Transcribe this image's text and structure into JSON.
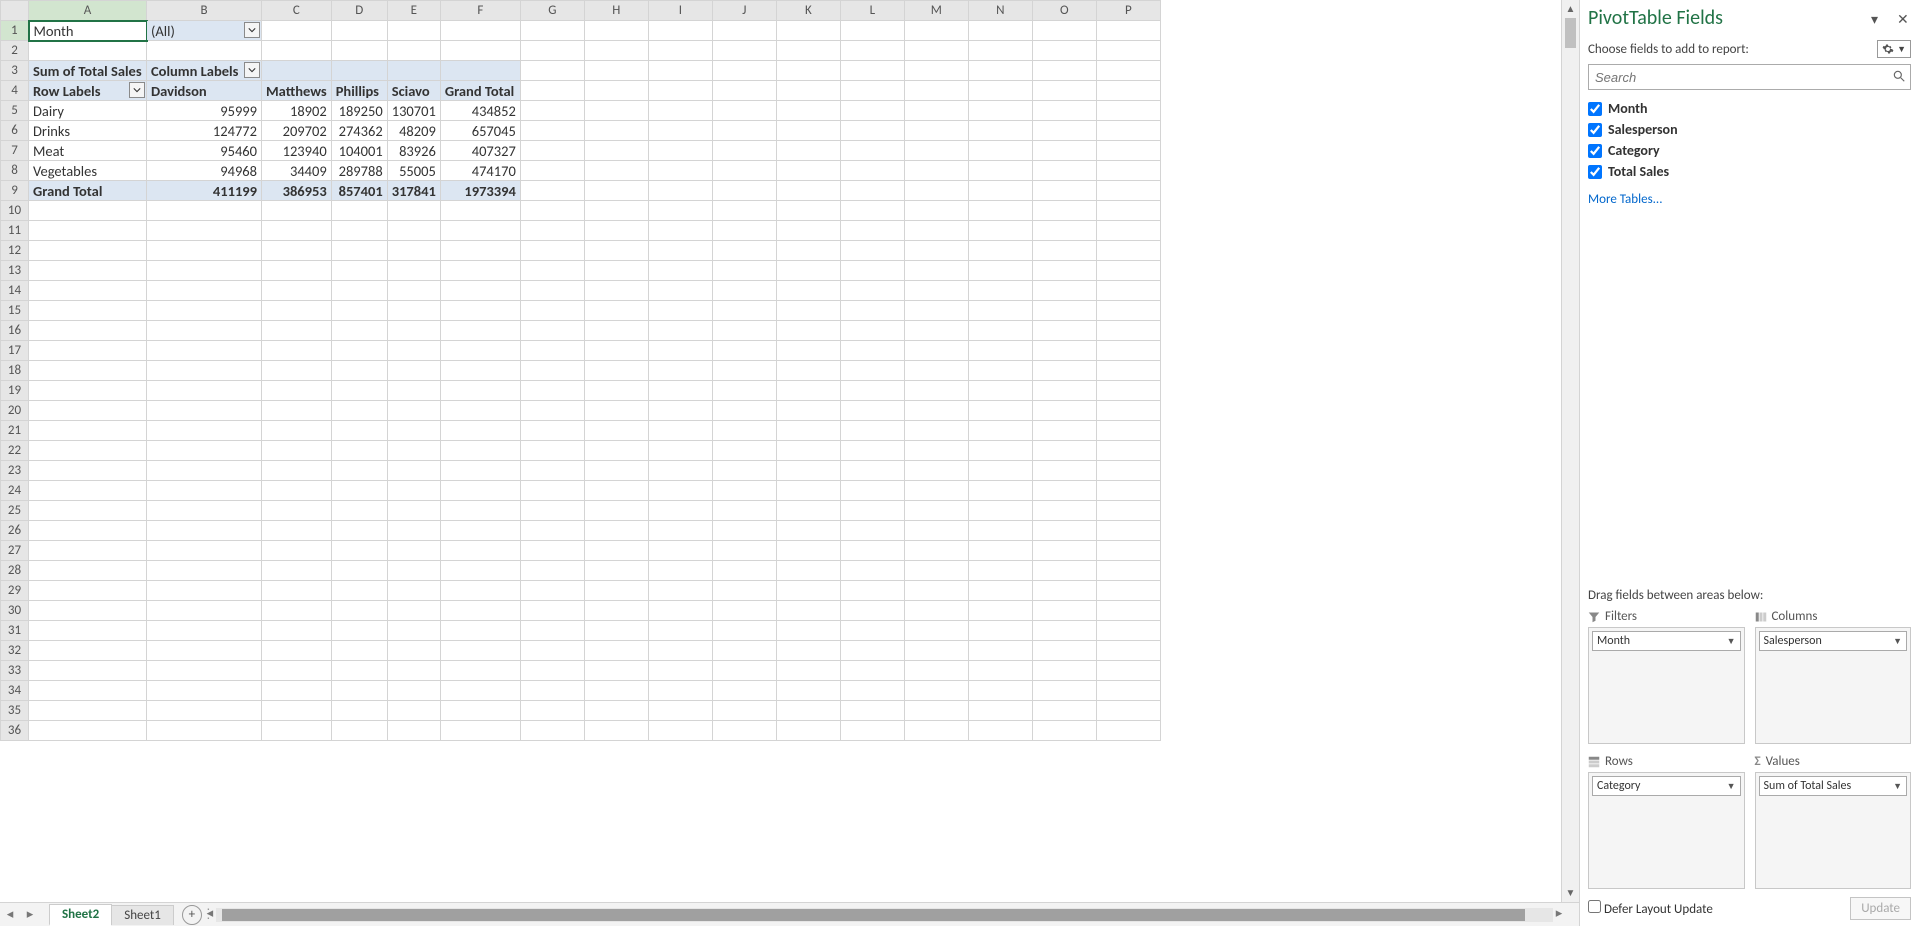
{
  "columns": [
    "A",
    "B",
    "C",
    "D",
    "E",
    "F",
    "G",
    "H",
    "I",
    "J",
    "K",
    "L",
    "M",
    "N",
    "O",
    "P"
  ],
  "rows": 36,
  "cell": {
    "A1": "Month",
    "B1": "(All)",
    "A3": "Sum of Total Sales",
    "B3": "Column Labels",
    "A4": "Row Labels",
    "B4": "Davidson",
    "C4": "Matthews",
    "D4": "Phillips",
    "E4": "Sciavo",
    "F4": "Grand Total",
    "A5": "Dairy",
    "B5": "95999",
    "C5": "18902",
    "D5": "189250",
    "E5": "130701",
    "F5": "434852",
    "A6": "Drinks",
    "B6": "124772",
    "C6": "209702",
    "D6": "274362",
    "E6": "48209",
    "F6": "657045",
    "A7": "Meat",
    "B7": "95460",
    "C7": "123940",
    "D7": "104001",
    "E7": "83926",
    "F7": "407327",
    "A8": "Vegetables",
    "B8": "94968",
    "C8": "34409",
    "D8": "289788",
    "E8": "55005",
    "F8": "474170",
    "A9": "Grand Total",
    "B9": "411199",
    "C9": "386953",
    "D9": "857401",
    "E9": "317841",
    "F9": "1973394"
  },
  "colWidths": {
    "A": 118,
    "B": 115,
    "C": 68,
    "D": 56,
    "E": 52,
    "F": 80
  },
  "defColW": 64,
  "tabs": {
    "active": "Sheet2",
    "other": "Sheet1"
  },
  "panel": {
    "title": "PivotTable Fields",
    "sub": "Choose fields to add to report:",
    "searchPlaceholder": "Search",
    "fields": [
      "Month",
      "Salesperson",
      "Category",
      "Total Sales"
    ],
    "more": "More Tables...",
    "dragLabel": "Drag fields between areas below:",
    "areas": {
      "filters": {
        "label": "Filters",
        "item": "Month"
      },
      "columns": {
        "label": "Columns",
        "item": "Salesperson"
      },
      "rows": {
        "label": "Rows",
        "item": "Category"
      },
      "values": {
        "label": "Values",
        "item": "Sum of Total Sales"
      }
    },
    "defer": "Defer Layout Update",
    "update": "Update"
  }
}
